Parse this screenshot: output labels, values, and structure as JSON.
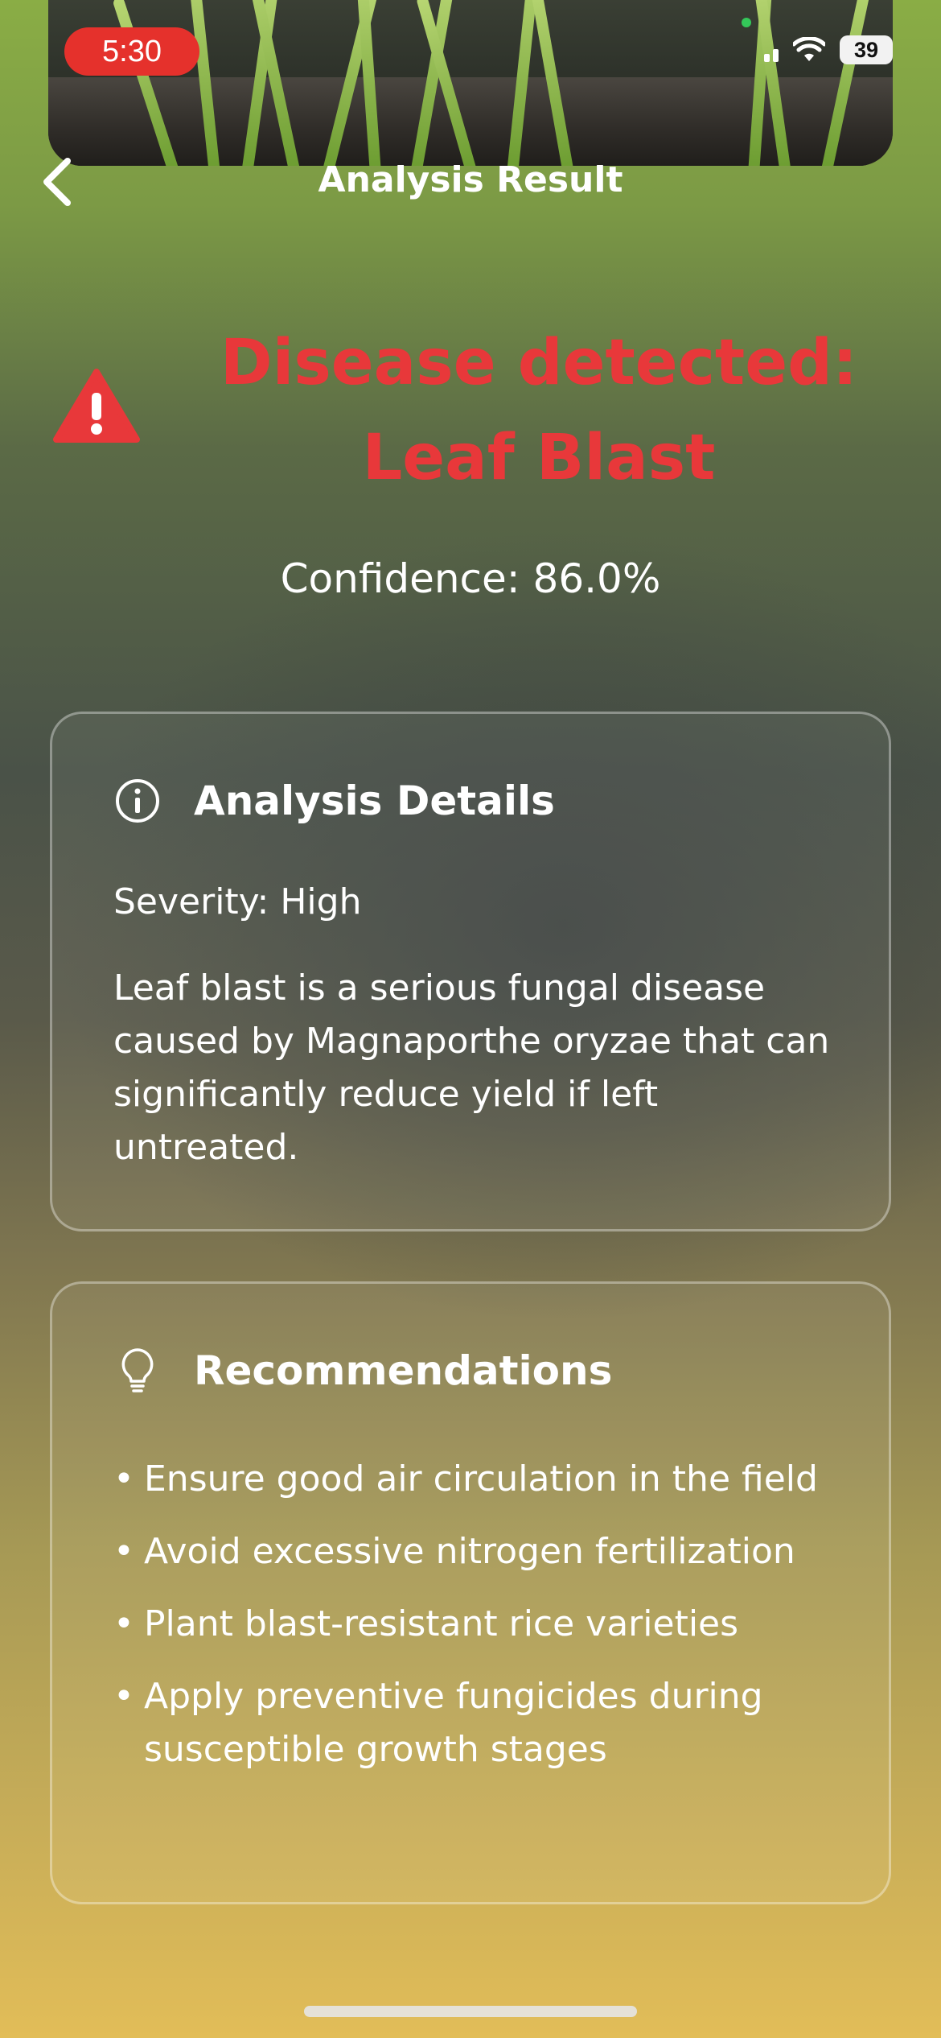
{
  "status_bar": {
    "time": "5:30",
    "battery": "39",
    "icons": [
      "signal-icon",
      "wifi-icon",
      "battery-icon"
    ]
  },
  "nav": {
    "title": "Analysis Result",
    "back_icon": "chevron-left-icon"
  },
  "result": {
    "headline": "Disease detected: Leaf Blast",
    "headline_color": "#e8383a",
    "warning_icon": "warning-triangle-icon",
    "confidence": "Confidence: 86.0%"
  },
  "details_card": {
    "icon": "info-circle-icon",
    "title": "Analysis Details",
    "severity": "Severity: High",
    "description": "Leaf blast is a serious fungal disease caused by Magnaporthe oryzae that can significantly reduce yield if left untreated."
  },
  "recommendations_card": {
    "icon": "lightbulb-icon",
    "title": "Recommendations",
    "items": [
      "Ensure good air circulation in the field",
      "Avoid excessive nitrogen fertilization",
      "Plant blast-resistant rice varieties",
      "Apply preventive fungicides during susceptible growth stages"
    ]
  }
}
